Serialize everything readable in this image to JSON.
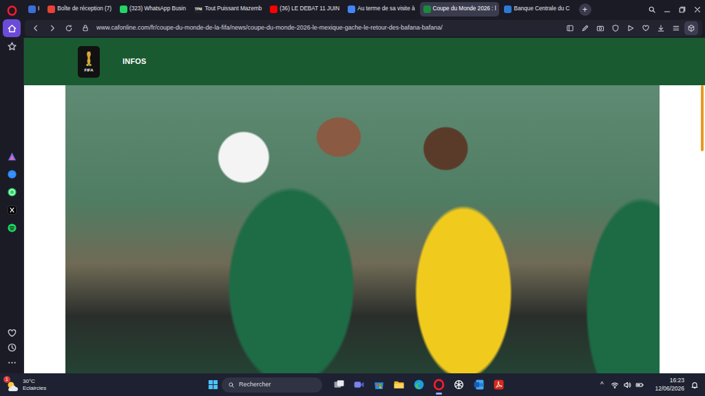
{
  "browser": {
    "sidebar": {
      "top": [
        {
          "kind": "opera",
          "selected": false
        },
        {
          "kind": "home",
          "selected": true
        },
        {
          "kind": "star",
          "selected": false
        }
      ],
      "apps": [
        {
          "kind": "aria",
          "selected": false
        },
        {
          "kind": "messenger",
          "selected": false
        },
        {
          "kind": "whatsapp",
          "selected": false
        },
        {
          "kind": "x",
          "selected": false
        },
        {
          "kind": "spotify",
          "selected": false
        }
      ],
      "bottom": [
        {
          "kind": "heart",
          "selected": false
        },
        {
          "kind": "history",
          "selected": false
        },
        {
          "kind": "more",
          "selected": false
        }
      ]
    },
    "tabs": [
      {
        "label": "I",
        "selected": false,
        "color": "#3b6fd8"
      },
      {
        "label": "Boîte de réception (7)",
        "selected": false,
        "color": "#ea4335"
      },
      {
        "label": "(323) WhatsApp Busin",
        "selected": false,
        "color": "#25d366"
      },
      {
        "label": "Tout Puissant Mazemb",
        "selected": false,
        "color": "#222222",
        "icon_text": "TPM"
      },
      {
        "label": "(36) LE DEBAT 11 JUIN",
        "selected": false,
        "color": "#ff0000"
      },
      {
        "label": "Au terme de sa visite à",
        "selected": false,
        "color": "#4285f4"
      },
      {
        "label": "Coupe du Monde 2026 : l",
        "selected": true,
        "color": "#1a8a3c"
      },
      {
        "label": "Banque Centrale du C",
        "selected": false,
        "color": "#2a7bd8"
      }
    ],
    "new_tab": "+",
    "url": "www.cafonline.com/fr/coupe-du-monde-de-la-fifa/news/coupe-du-monde-2026-le-mexique-gache-le-retour-des-bafana-bafana/"
  },
  "page": {
    "header": {
      "logo_caption": "FIFA",
      "title": "INFOS"
    },
    "scrollbar": {
      "level": 0.23
    }
  },
  "taskbar": {
    "weather": {
      "temperature": "30°C",
      "condition": "Eclaircies",
      "badge": "1"
    },
    "search": {
      "placeholder": "Rechercher"
    },
    "apps": [
      {
        "kind": "taskview",
        "selected": false
      },
      {
        "kind": "meet",
        "selected": false
      },
      {
        "kind": "store",
        "selected": false
      },
      {
        "kind": "explorer",
        "selected": false
      },
      {
        "kind": "edge",
        "selected": false
      },
      {
        "kind": "opera",
        "selected": true
      },
      {
        "kind": "chatgpt",
        "selected": false
      },
      {
        "kind": "word",
        "selected": false
      },
      {
        "kind": "acrobat",
        "selected": false
      }
    ],
    "tray": {
      "chevron": "^"
    },
    "clock": {
      "time": "16:23",
      "date": "12/06/2026"
    }
  }
}
